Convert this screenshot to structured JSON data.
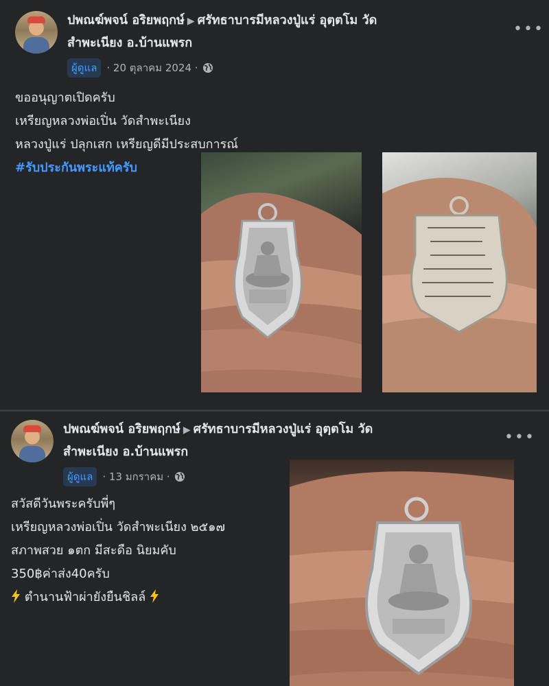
{
  "posts": [
    {
      "author": "ปพณฆ์พจน์ อริยพฤกษ์",
      "group_line1": "ศรัทธาบารมีหลวงปู่แร่ อุตฺตโม วัด",
      "group_line2": "สำพะเนียง อ.บ้านแพรก",
      "badge": "ผู้ดูแล",
      "date": "· 20 ตุลาคม 2024 ·",
      "lines": [
        "ขออนุญาตเปิดครับ",
        "เหรียญหลวงพ่อเปิ่น วัดสำพะเนียง",
        "หลวงปู่แร่ ปลุกเสก เหรียญดีมีประสบการณ์"
      ],
      "hashtag": "#รับประกันพระแท้ครับ"
    },
    {
      "author": "ปพณฆ์พจน์ อริยพฤกษ์",
      "group_line1": "ศรัทธาบารมีหลวงปู่แร่ อุตฺตโม วัด",
      "group_line2": "สำพะเนียง อ.บ้านแพรก",
      "badge": "ผู้ดูแล",
      "date": "· 13 มกราคม ·",
      "lines": [
        "สวัสดีวันพระครับพี่ๆ",
        "เหรียญหลวงพ่อเปิ่น วัดสำพะเนียง ๒๕๑๗",
        "สภาพสวย ๑ตก มีสะดือ นิยมคับ",
        "350฿ค่าส่ง40ครับ"
      ],
      "last_line": "ตำนานฟ้าผ่ายังยืนชิลล์"
    }
  ],
  "more_label": "•••",
  "icons": [
    "globe-icon",
    "more-options-icon",
    "lightning-icon",
    "caret-right-icon"
  ],
  "colors": {
    "background": "#242526",
    "text": "#e4e6eb",
    "secondary": "#b0b3b8",
    "link": "#4599ff",
    "badge_bg": "#263951"
  }
}
